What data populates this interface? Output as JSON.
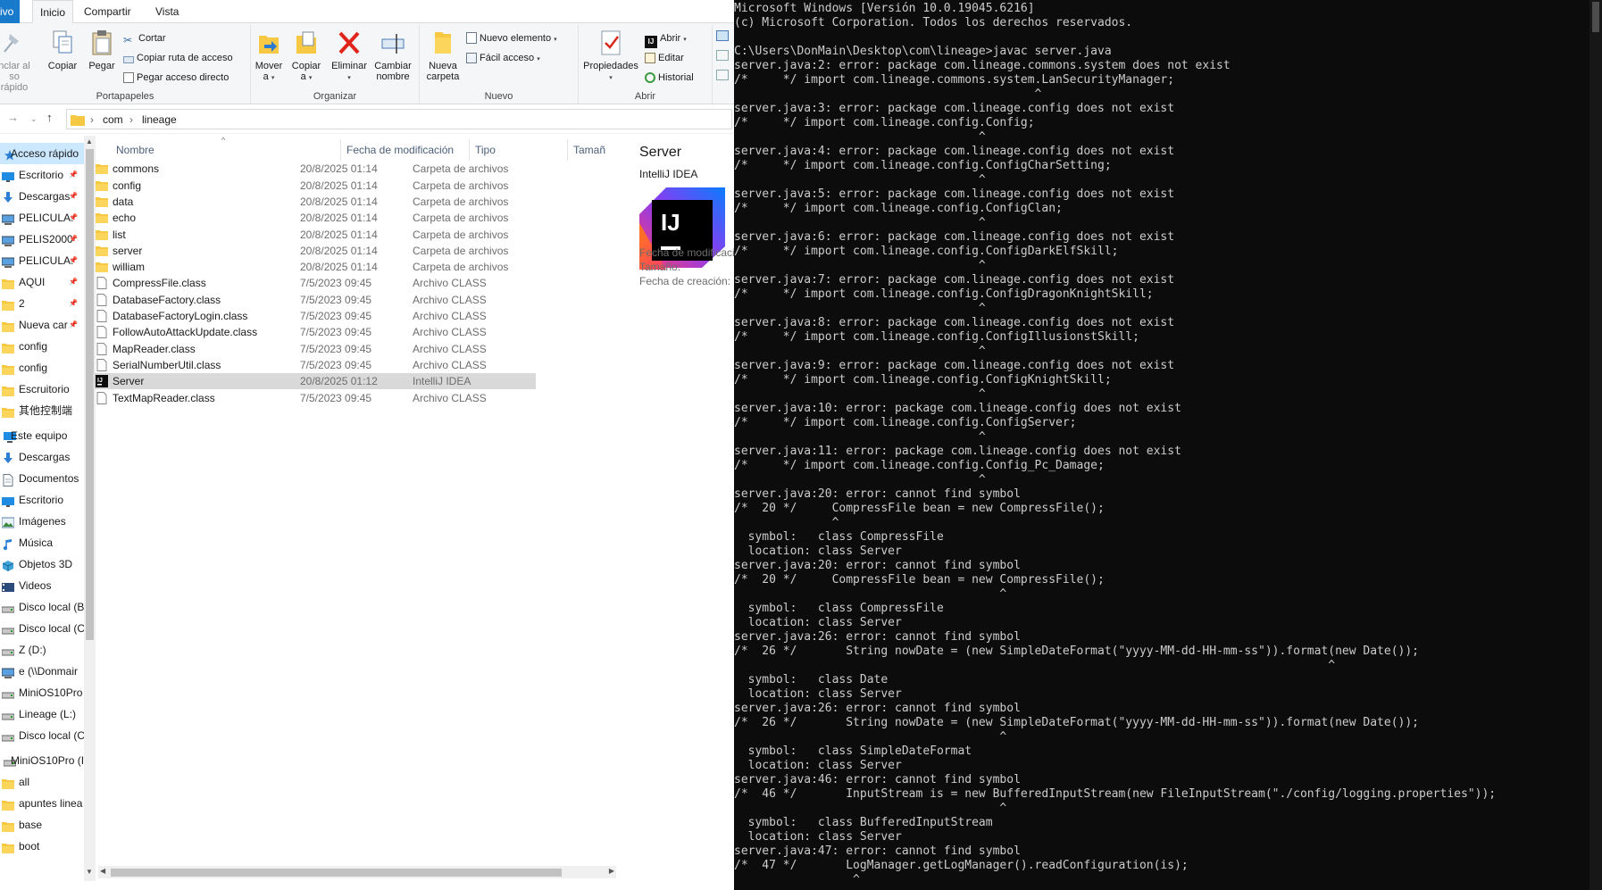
{
  "ribbon": {
    "tabs": [
      "ivo",
      "Inicio",
      "Compartir",
      "Vista"
    ],
    "groups": {
      "portapapeles": "Portapapeles",
      "organizar": "Organizar",
      "nuevo": "Nuevo",
      "abrir": "Abrir"
    },
    "anclar": [
      "nclar al",
      "so rápido"
    ],
    "copiar": "Copiar",
    "pegar": "Pegar",
    "cortar": "Cortar",
    "copiar_ruta": "Copiar ruta de acceso",
    "pegar_acceso": "Pegar acceso directo",
    "mover": [
      "Mover",
      "a"
    ],
    "copiar_a": [
      "Copiar",
      "a"
    ],
    "eliminar": "Eliminar",
    "cambiar": [
      "Cambiar",
      "nombre"
    ],
    "nueva_carpeta": [
      "Nueva",
      "carpeta"
    ],
    "nuevo_elemento": "Nuevo elemento",
    "facil_acceso": "Fácil acceso",
    "propiedades": "Propiedades",
    "abrir": "Abrir",
    "editar": "Editar",
    "historial": "Historial"
  },
  "address": {
    "crumbs": [
      "com",
      "lineage"
    ]
  },
  "sidebar": {
    "items": [
      {
        "label": "Acceso rápido",
        "icon": "star-icon",
        "pinned": false
      },
      {
        "label": "Escritorio",
        "icon": "desktop-icon",
        "pinned": true
      },
      {
        "label": "Descargas",
        "icon": "download-icon",
        "pinned": true
      },
      {
        "label": "PELICULA:",
        "icon": "network-drive-icon",
        "pinned": true
      },
      {
        "label": "PELIS2000",
        "icon": "network-drive-icon",
        "pinned": true
      },
      {
        "label": "PELICULA:",
        "icon": "network-drive-icon",
        "pinned": true
      },
      {
        "label": "AQUI",
        "icon": "folder-icon",
        "pinned": true
      },
      {
        "label": "2",
        "icon": "folder-icon",
        "pinned": true
      },
      {
        "label": "Nueva car",
        "icon": "folder-icon",
        "pinned": true
      },
      {
        "label": "config",
        "icon": "folder-icon",
        "pinned": false
      },
      {
        "label": "config",
        "icon": "folder-icon",
        "pinned": false
      },
      {
        "label": "Escruitorio",
        "icon": "folder-icon",
        "pinned": false
      },
      {
        "label": "其他控制端",
        "icon": "folder-icon",
        "pinned": false
      },
      {
        "label": "Este equipo",
        "icon": "computer-icon",
        "pinned": false
      },
      {
        "label": "Descargas",
        "icon": "download-icon",
        "pinned": false
      },
      {
        "label": "Documentos",
        "icon": "documents-icon",
        "pinned": false
      },
      {
        "label": "Escritorio",
        "icon": "desktop-icon",
        "pinned": false
      },
      {
        "label": "Imágenes",
        "icon": "pictures-icon",
        "pinned": false
      },
      {
        "label": "Música",
        "icon": "music-icon",
        "pinned": false
      },
      {
        "label": "Objetos 3D",
        "icon": "3d-objects-icon",
        "pinned": false
      },
      {
        "label": "Videos",
        "icon": "videos-icon",
        "pinned": false
      },
      {
        "label": "Disco local (B",
        "icon": "drive-icon",
        "pinned": false
      },
      {
        "label": "Disco local (C",
        "icon": "drive-icon",
        "pinned": false
      },
      {
        "label": "Z (D:)",
        "icon": "drive-icon",
        "pinned": false
      },
      {
        "label": "e (\\\\Donmair",
        "icon": "network-drive-icon",
        "pinned": false
      },
      {
        "label": "MiniOS10Pro",
        "icon": "drive-icon",
        "pinned": false
      },
      {
        "label": "Lineage (L:)",
        "icon": "drive-icon",
        "pinned": false
      },
      {
        "label": "Disco local (C",
        "icon": "drive-icon",
        "pinned": false
      },
      {
        "label": "MiniOS10Pro (I",
        "icon": "drive-icon",
        "pinned": false
      },
      {
        "label": "all",
        "icon": "folder-icon",
        "pinned": false
      },
      {
        "label": "apuntes linea",
        "icon": "folder-icon",
        "pinned": false
      },
      {
        "label": "base",
        "icon": "folder-icon",
        "pinned": false
      },
      {
        "label": "boot",
        "icon": "folder-icon",
        "pinned": false
      }
    ]
  },
  "filelist": {
    "columns": [
      "Nombre",
      "Fecha de modificación",
      "Tipo",
      "Tamañ"
    ],
    "rows": [
      {
        "name": "commons",
        "date": "20/8/2025 01:14",
        "type": "Carpeta de archivos",
        "icon": "folder-icon",
        "selected": false
      },
      {
        "name": "config",
        "date": "20/8/2025 01:14",
        "type": "Carpeta de archivos",
        "icon": "folder-icon",
        "selected": false
      },
      {
        "name": "data",
        "date": "20/8/2025 01:14",
        "type": "Carpeta de archivos",
        "icon": "folder-icon",
        "selected": false
      },
      {
        "name": "echo",
        "date": "20/8/2025 01:14",
        "type": "Carpeta de archivos",
        "icon": "folder-icon",
        "selected": false
      },
      {
        "name": "list",
        "date": "20/8/2025 01:14",
        "type": "Carpeta de archivos",
        "icon": "folder-icon",
        "selected": false
      },
      {
        "name": "server",
        "date": "20/8/2025 01:14",
        "type": "Carpeta de archivos",
        "icon": "folder-icon",
        "selected": false
      },
      {
        "name": "william",
        "date": "20/8/2025 01:14",
        "type": "Carpeta de archivos",
        "icon": "folder-icon",
        "selected": false
      },
      {
        "name": "CompressFile.class",
        "date": "7/5/2023 09:45",
        "type": "Archivo CLASS",
        "icon": "file-icon",
        "selected": false
      },
      {
        "name": "DatabaseFactory.class",
        "date": "7/5/2023 09:45",
        "type": "Archivo CLASS",
        "icon": "file-icon",
        "selected": false
      },
      {
        "name": "DatabaseFactoryLogin.class",
        "date": "7/5/2023 09:45",
        "type": "Archivo CLASS",
        "icon": "file-icon",
        "selected": false
      },
      {
        "name": "FollowAutoAttackUpdate.class",
        "date": "7/5/2023 09:45",
        "type": "Archivo CLASS",
        "icon": "file-icon",
        "selected": false
      },
      {
        "name": "MapReader.class",
        "date": "7/5/2023 09:45",
        "type": "Archivo CLASS",
        "icon": "file-icon",
        "selected": false
      },
      {
        "name": "SerialNumberUtil.class",
        "date": "7/5/2023 09:45",
        "type": "Archivo CLASS",
        "icon": "file-icon",
        "selected": false
      },
      {
        "name": "Server",
        "date": "20/8/2025 01:12",
        "type": "IntelliJ IDEA",
        "icon": "intellij-icon",
        "selected": true
      },
      {
        "name": "TextMapReader.class",
        "date": "7/5/2023 09:45",
        "type": "Archivo CLASS",
        "icon": "file-icon",
        "selected": false
      }
    ]
  },
  "preview": {
    "title": "Server",
    "subtitle": "IntelliJ IDEA",
    "logo_text": "IJ",
    "props": [
      "Fecha de modificaci",
      "Tamaño:",
      "Fecha de creación:"
    ]
  },
  "console": {
    "lines": [
      "Microsoft Windows [Versión 10.0.19045.6216]",
      "(c) Microsoft Corporation. Todos los derechos reservados.",
      "",
      "C:\\Users\\DonMain\\Desktop\\com\\lineage>javac server.java",
      "server.java:2: error: package com.lineage.commons.system does not exist",
      "/*     */ import com.lineage.commons.system.LanSecurityManager;",
      "                                           ^",
      "server.java:3: error: package com.lineage.config does not exist",
      "/*     */ import com.lineage.config.Config;",
      "                                   ^",
      "server.java:4: error: package com.lineage.config does not exist",
      "/*     */ import com.lineage.config.ConfigCharSetting;",
      "                                   ^",
      "server.java:5: error: package com.lineage.config does not exist",
      "/*     */ import com.lineage.config.ConfigClan;",
      "                                   ^",
      "server.java:6: error: package com.lineage.config does not exist",
      "/*     */ import com.lineage.config.ConfigDarkElfSkill;",
      "                                   ^",
      "server.java:7: error: package com.lineage.config does not exist",
      "/*     */ import com.lineage.config.ConfigDragonKnightSkill;",
      "                                   ^",
      "server.java:8: error: package com.lineage.config does not exist",
      "/*     */ import com.lineage.config.ConfigIllusionstSkill;",
      "                                   ^",
      "server.java:9: error: package com.lineage.config does not exist",
      "/*     */ import com.lineage.config.ConfigKnightSkill;",
      "                                   ^",
      "server.java:10: error: package com.lineage.config does not exist",
      "/*     */ import com.lineage.config.ConfigServer;",
      "                                   ^",
      "server.java:11: error: package com.lineage.config does not exist",
      "/*     */ import com.lineage.config.Config_Pc_Damage;",
      "                                   ^",
      "server.java:20: error: cannot find symbol",
      "/*  20 */     CompressFile bean = new CompressFile();",
      "              ^",
      "  symbol:   class CompressFile",
      "  location: class Server",
      "server.java:20: error: cannot find symbol",
      "/*  20 */     CompressFile bean = new CompressFile();",
      "                                      ^",
      "  symbol:   class CompressFile",
      "  location: class Server",
      "server.java:26: error: cannot find symbol",
      "/*  26 */       String nowDate = (new SimpleDateFormat(\"yyyy-MM-dd-HH-mm-ss\")).format(new Date());",
      "                                                                                     ^",
      "  symbol:   class Date",
      "  location: class Server",
      "server.java:26: error: cannot find symbol",
      "/*  26 */       String nowDate = (new SimpleDateFormat(\"yyyy-MM-dd-HH-mm-ss\")).format(new Date());",
      "                                      ^",
      "  symbol:   class SimpleDateFormat",
      "  location: class Server",
      "server.java:46: error: cannot find symbol",
      "/*  46 */       InputStream is = new BufferedInputStream(new FileInputStream(\"./config/logging.properties\"));",
      "                                      ^",
      "  symbol:   class BufferedInputStream",
      "  location: class Server",
      "server.java:47: error: cannot find symbol",
      "/*  47 */       LogManager.getLogManager().readConfiguration(is);",
      "                 ^"
    ]
  }
}
